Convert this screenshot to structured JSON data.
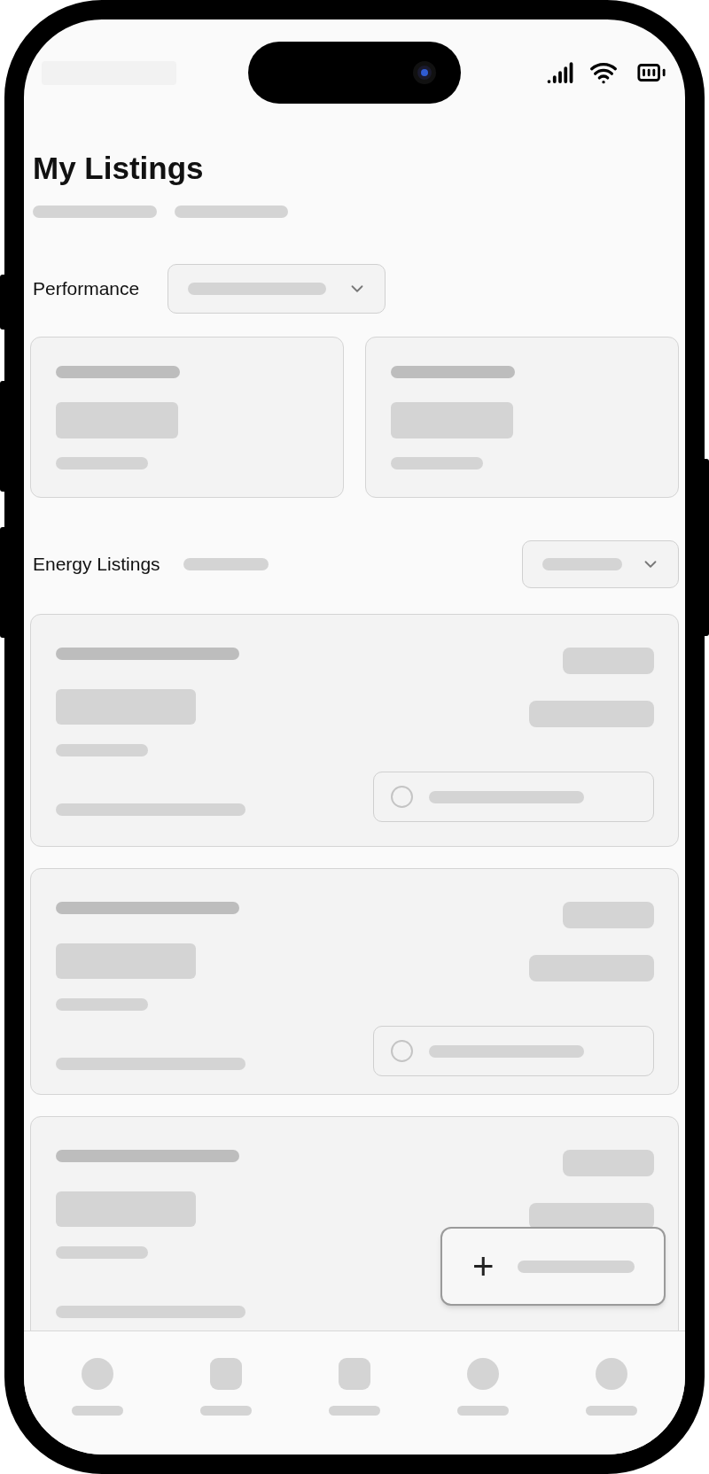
{
  "page": {
    "title": "My Listings"
  },
  "performance": {
    "label": "Performance"
  },
  "energy": {
    "label": "Energy Listings"
  },
  "listings": [
    {
      "status_chip": true
    },
    {
      "status_chip": true
    },
    {
      "status_chip": false
    }
  ],
  "fab": {
    "icon": "+"
  },
  "nav_items": [
    {
      "kind": "circle"
    },
    {
      "kind": "square"
    },
    {
      "kind": "square"
    },
    {
      "kind": "circle"
    },
    {
      "kind": "circle"
    }
  ]
}
